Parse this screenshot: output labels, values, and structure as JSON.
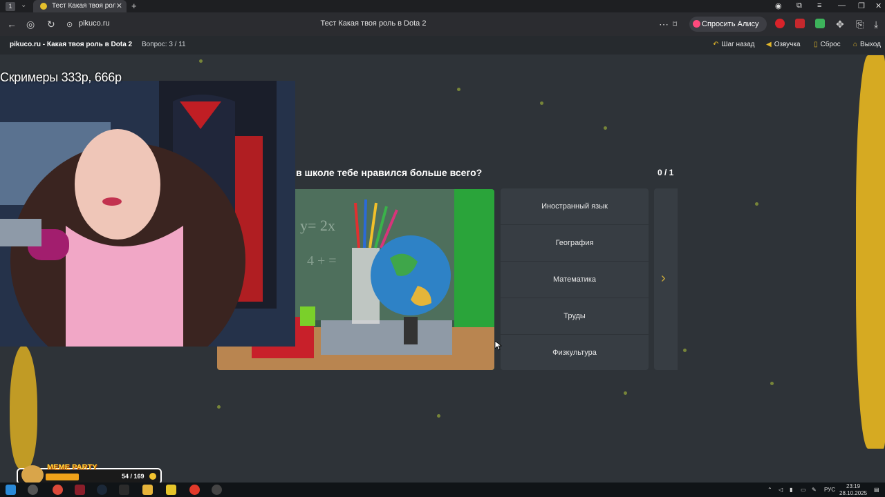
{
  "browser": {
    "tab_number": "1",
    "tab_title": "Тест Какая твоя роль в",
    "url": "pikuco.ru",
    "page_title": "Тест Какая твоя роль в Dota 2",
    "alice_button": "Спросить Алису AI"
  },
  "site_header": {
    "brand": "pikuco.ru - Какая твоя роль в Dota 2",
    "question_counter": "Вопрос: 3 / 11",
    "links": {
      "back": "Шаг назад",
      "voice": "Озвучка",
      "reset": "Сброс",
      "exit": "Выход"
    }
  },
  "quiz": {
    "question": "в школе тебе нравился больше всего?",
    "score": "0 / 1",
    "answers": [
      "Иностранный язык",
      "География",
      "Математика",
      "Труды",
      "Физкультура"
    ]
  },
  "stream": {
    "overlay_title": "Скримеры 333р, 666р",
    "meme_party_label": "MEME PARTY",
    "meme_party_count": "54 / 169",
    "meme_party_progress": 0.32
  },
  "taskbar": {
    "language": "РУС",
    "time": "23:19",
    "date": "28.10.2025"
  },
  "colors": {
    "accent_gold": "#d6aa22",
    "bg": "#2e3338",
    "panel": "#373d43"
  }
}
